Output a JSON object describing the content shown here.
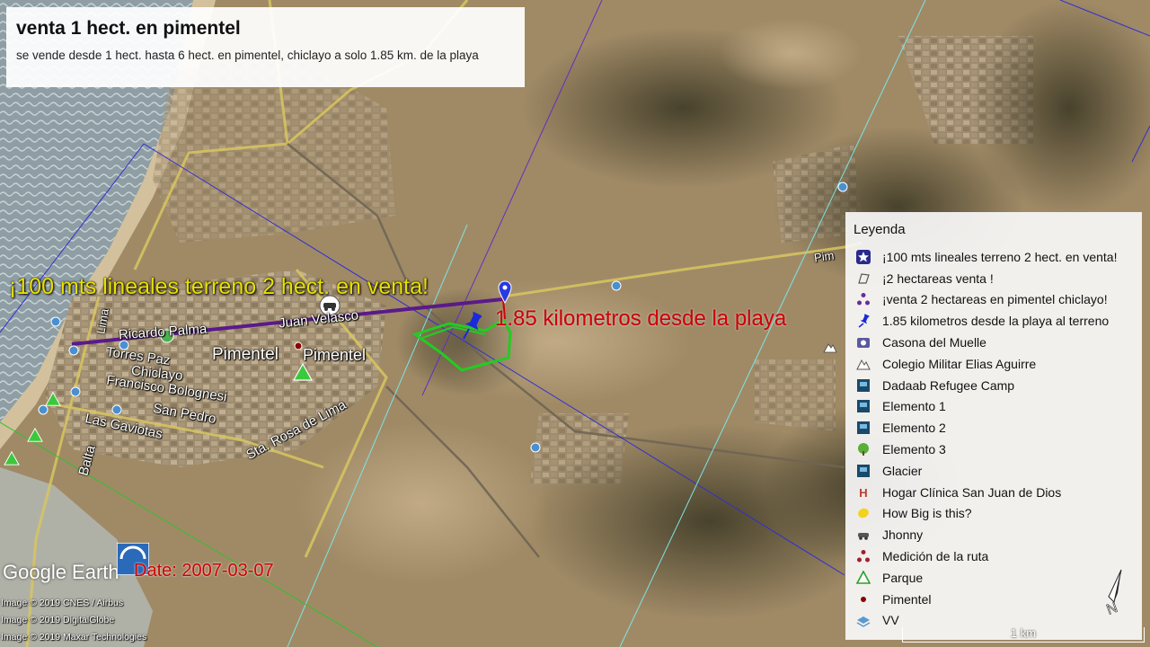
{
  "title_box": {
    "title": "venta 1 hect. en pimentel",
    "subtitle": "se vende desde 1 hect. hasta 6 hect. en pimentel, chiclayo a solo 1.85 km. de la playa"
  },
  "map_labels": {
    "terreno_label": "¡100 mts lineales terreno 2 hect. en venta!",
    "distance_label": "1.85 kilometros desde la playa",
    "town": "Pimentel",
    "town_small": "Pimentel",
    "streets": {
      "ricardo_palma": "Ricardo Palma",
      "juan_velasco": "Juan Velasco",
      "lima": "Lima",
      "torres_paz": "Torres Paz",
      "chiclayo": "Chiclayo",
      "francisco_bolognesi": "Francisco Bolognesi",
      "san_pedro": "San Pedro",
      "las_gaviotas": "Las Gaviotas",
      "balta": "Balta",
      "sta_rosa_de_lima": "Sta. Rosa de Lima",
      "pimentel_road": "Pim"
    }
  },
  "legend": {
    "title": "Leyenda",
    "items": [
      {
        "label": "¡100 mts lineales terreno 2 hect. en venta!",
        "icon": "star-marker-icon"
      },
      {
        "label": "¡2 hectareas venta !",
        "icon": "polygon-outline-icon"
      },
      {
        "label": "¡venta 2 hectareas en pimentel chiclayo!",
        "icon": "triangle-dots-icon"
      },
      {
        "label": "1.85 kilometros desde la playa al terreno",
        "icon": "pushpin-icon"
      },
      {
        "label": "Casona del Muelle",
        "icon": "camera-icon"
      },
      {
        "label": "Colegio Militar Elias Aguirre",
        "icon": "mountain-icon"
      },
      {
        "label": "Dadaab Refugee Camp",
        "icon": "photo-icon"
      },
      {
        "label": "Elemento 1",
        "icon": "photo-icon"
      },
      {
        "label": "Elemento 2",
        "icon": "photo-icon"
      },
      {
        "label": "Elemento 3",
        "icon": "tree-icon"
      },
      {
        "label": "Glacier",
        "icon": "photo-icon"
      },
      {
        "label": "Hogar Clínica San Juan de Dios",
        "icon": "hospital-icon"
      },
      {
        "label": "How Big is this?",
        "icon": "yellow-balloon-icon"
      },
      {
        "label": "Jhonny",
        "icon": "car-icon"
      },
      {
        "label": "Medición de la ruta",
        "icon": "route-dots-icon"
      },
      {
        "label": "Parque",
        "icon": "park-triangle-icon"
      },
      {
        "label": "Pimentel",
        "icon": "red-dot-icon"
      },
      {
        "label": "VV",
        "icon": "layers-icon"
      }
    ]
  },
  "branding": {
    "google_earth": "Google Earth",
    "date": "Date: 2007-03-07"
  },
  "attribution": [
    "Image © 2019 CNES / Airbus",
    "Image © 2019 DigitalGlobe",
    "Image © 2019 Maxar Technologies"
  ],
  "scale": {
    "label": "1 km"
  },
  "colors": {
    "sea": "#8a9aa0",
    "land": "#a08a66",
    "terreno_label": "#e8e000",
    "distance_label": "#d00000",
    "purple_line": "#5a1a8a",
    "plot_outline": "#22cc22",
    "blue_line": "#3030d0"
  }
}
